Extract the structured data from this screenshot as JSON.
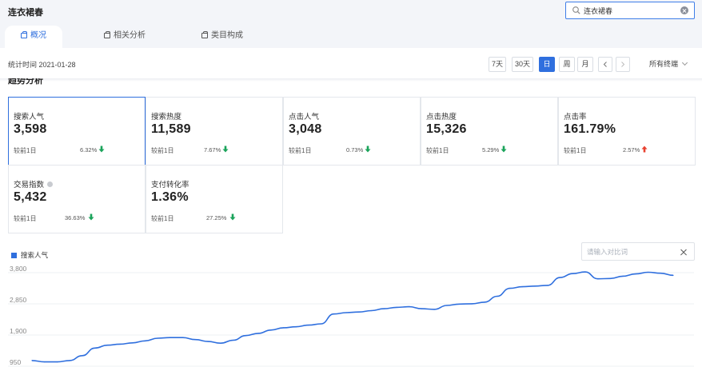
{
  "header": {
    "title": "连衣裙春"
  },
  "search": {
    "value": "连衣裙春"
  },
  "tabs": [
    {
      "label": "概况",
      "active": true
    },
    {
      "label": "相关分析",
      "active": false
    },
    {
      "label": "类目构成",
      "active": false
    }
  ],
  "toolbar": {
    "stat_time": "统计时间 2021-01-28",
    "periods": [
      "7天",
      "30天",
      "日",
      "周",
      "月"
    ],
    "active_period": "日",
    "prev_icon": "chevron-left-icon",
    "next_icon": "chevron-right-icon",
    "terminal": "所有终端"
  },
  "section_title": "趋势分析",
  "metrics": [
    {
      "label": "搜索人气",
      "value": "3,598",
      "compare": "较前1日",
      "change": "6.32%",
      "direction": "down",
      "selected": true
    },
    {
      "label": "搜索热度",
      "value": "11,589",
      "compare": "较前1日",
      "change": "7.67%",
      "direction": "down",
      "selected": false
    },
    {
      "label": "点击人气",
      "value": "3,048",
      "compare": "较前1日",
      "change": "0.73%",
      "direction": "down",
      "selected": false
    },
    {
      "label": "点击热度",
      "value": "15,326",
      "compare": "较前1日",
      "change": "5.29%",
      "direction": "down",
      "selected": false
    },
    {
      "label": "点击率",
      "value": "161.79%",
      "compare": "较前1日",
      "change": "2.57%",
      "direction": "up",
      "selected": false
    },
    {
      "label": "交易指数",
      "value": "5,432",
      "compare": "较前1日",
      "change": "36.63%",
      "direction": "down",
      "selected": false,
      "info_icon": "info-icon"
    },
    {
      "label": "支付转化率",
      "value": "1.36%",
      "compare": "较前1日",
      "change": "27.25%",
      "direction": "down",
      "selected": false
    }
  ],
  "colors": {
    "accent": "#2f6fde",
    "down": "#1aa35a",
    "up": "#e8412f",
    "line": "#2f6fde"
  },
  "compare": {
    "placeholder": "请输入对比词",
    "close_icon": "close-icon"
  },
  "chart_data": {
    "type": "line",
    "series": [
      {
        "name": "搜索人气",
        "values": [
          1000,
          960,
          960,
          1000,
          1150,
          1380,
          1470,
          1500,
          1540,
          1600,
          1680,
          1700,
          1700,
          1640,
          1580,
          1530,
          1620,
          1760,
          1830,
          1930,
          2000,
          2030,
          2080,
          2120,
          2420,
          2460,
          2480,
          2520,
          2580,
          2620,
          2640,
          2580,
          2560,
          2680,
          2720,
          2730,
          2780,
          2960,
          3200,
          3250,
          3270,
          3290,
          3530,
          3650,
          3700,
          3490,
          3500,
          3570,
          3640,
          3690,
          3660,
          3598
        ]
      }
    ],
    "ylim": [
      950,
      3800
    ],
    "y_ticks": [
      950,
      1900,
      2850,
      3800
    ],
    "y_tick_labels": [
      "950",
      "1,900",
      "2,850",
      "3,800"
    ],
    "grid": true,
    "legend": "top-left"
  }
}
